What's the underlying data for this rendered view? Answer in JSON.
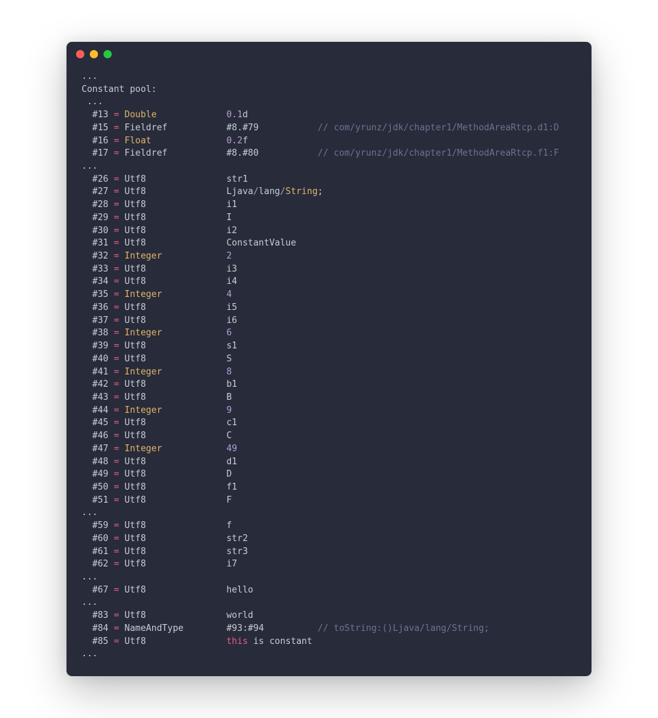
{
  "header_line1": "...",
  "header_line2": "Constant pool:",
  "header_line3": " ...",
  "ellipsis_rows": {
    "a": "...",
    "b": "...",
    "c": "...",
    "d": "...",
    "e": "..."
  },
  "lines": {
    "l13": {
      "idx": "#13",
      "type": "Double",
      "value_num": "0.1",
      "value_suffix": "d"
    },
    "l15": {
      "idx": "#15",
      "type": "Fieldref",
      "value_plain": "#8.#79",
      "comment": "// com/yrunz/jdk/chapter1/MethodAreaRtcp.d1:D"
    },
    "l16": {
      "idx": "#16",
      "type": "Float",
      "value_num": "0.2",
      "value_suffix": "f"
    },
    "l17": {
      "idx": "#17",
      "type": "Fieldref",
      "value_plain": "#8.#80",
      "comment": "// com/yrunz/jdk/chapter1/MethodAreaRtcp.f1:F"
    },
    "l26": {
      "idx": "#26",
      "type": "Utf8",
      "value_plain": "str1"
    },
    "l27": {
      "idx": "#27",
      "type": "Utf8",
      "value_plain": "Ljava",
      "segA": "lang",
      "segB": "String",
      "segC": ";"
    },
    "l28": {
      "idx": "#28",
      "type": "Utf8",
      "value_plain": "i1"
    },
    "l29": {
      "idx": "#29",
      "type": "Utf8",
      "value_plain": "I"
    },
    "l30": {
      "idx": "#30",
      "type": "Utf8",
      "value_plain": "i2"
    },
    "l31": {
      "idx": "#31",
      "type": "Utf8",
      "value_plain": "ConstantValue"
    },
    "l32": {
      "idx": "#32",
      "type": "Integer",
      "value_num": "2"
    },
    "l33": {
      "idx": "#33",
      "type": "Utf8",
      "value_plain": "i3"
    },
    "l34": {
      "idx": "#34",
      "type": "Utf8",
      "value_plain": "i4"
    },
    "l35": {
      "idx": "#35",
      "type": "Integer",
      "value_num": "4"
    },
    "l36": {
      "idx": "#36",
      "type": "Utf8",
      "value_plain": "i5"
    },
    "l37": {
      "idx": "#37",
      "type": "Utf8",
      "value_plain": "i6"
    },
    "l38": {
      "idx": "#38",
      "type": "Integer",
      "value_num": "6"
    },
    "l39": {
      "idx": "#39",
      "type": "Utf8",
      "value_plain": "s1"
    },
    "l40": {
      "idx": "#40",
      "type": "Utf8",
      "value_plain": "S"
    },
    "l41": {
      "idx": "#41",
      "type": "Integer",
      "value_num": "8"
    },
    "l42": {
      "idx": "#42",
      "type": "Utf8",
      "value_plain": "b1"
    },
    "l43": {
      "idx": "#43",
      "type": "Utf8",
      "value_plain": "B"
    },
    "l44": {
      "idx": "#44",
      "type": "Integer",
      "value_num": "9"
    },
    "l45": {
      "idx": "#45",
      "type": "Utf8",
      "value_plain": "c1"
    },
    "l46": {
      "idx": "#46",
      "type": "Utf8",
      "value_plain": "C"
    },
    "l47": {
      "idx": "#47",
      "type": "Integer",
      "value_num": "49"
    },
    "l48": {
      "idx": "#48",
      "type": "Utf8",
      "value_plain": "d1"
    },
    "l49": {
      "idx": "#49",
      "type": "Utf8",
      "value_plain": "D"
    },
    "l50": {
      "idx": "#50",
      "type": "Utf8",
      "value_plain": "f1"
    },
    "l51": {
      "idx": "#51",
      "type": "Utf8",
      "value_plain": "F"
    },
    "l59": {
      "idx": "#59",
      "type": "Utf8",
      "value_plain": "f"
    },
    "l60": {
      "idx": "#60",
      "type": "Utf8",
      "value_plain": "str2"
    },
    "l61": {
      "idx": "#61",
      "type": "Utf8",
      "value_plain": "str3"
    },
    "l62": {
      "idx": "#62",
      "type": "Utf8",
      "value_plain": "i7"
    },
    "l67": {
      "idx": "#67",
      "type": "Utf8",
      "value_plain": "hello"
    },
    "l83": {
      "idx": "#83",
      "type": "Utf8",
      "value_plain": " world"
    },
    "l84": {
      "idx": "#84",
      "type": "NameAndType",
      "value_plain": "#93:#94",
      "comment": "// toString:()Ljava/lang/String;"
    },
    "l85": {
      "idx": "#85",
      "type": "Utf8",
      "kw": "this",
      "rest": " is constant"
    }
  },
  "colors": {
    "background": "#272b3a",
    "text": "#c8cdd6",
    "pink": "#e95b85",
    "gold": "#e3b46b",
    "purple": "#b4a0d8",
    "comment": "#6d7390"
  }
}
